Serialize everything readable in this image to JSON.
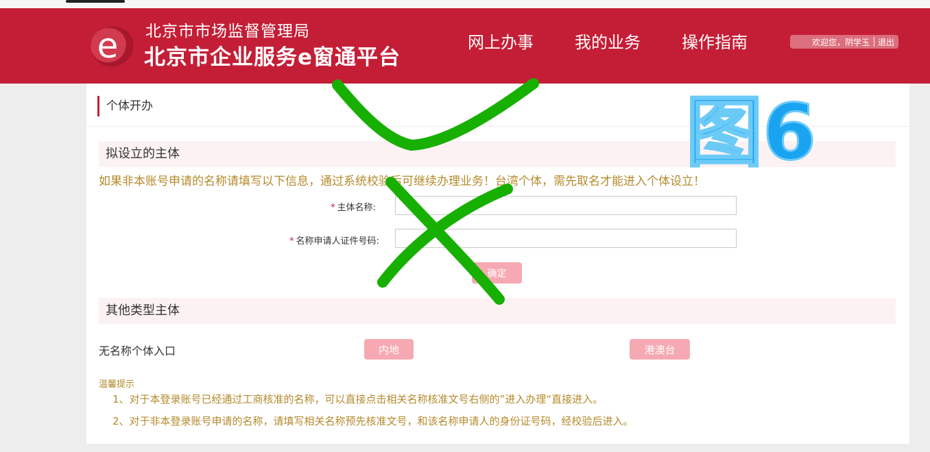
{
  "header": {
    "org_name": "北京市市场监督管理局",
    "platform_name": "北京市企业服务e窗通平台",
    "nav": [
      "网上办事",
      "我的业务",
      "操作指南"
    ],
    "welcome": "欢迎您，阴学玉",
    "logout": "退出"
  },
  "section_title": "个体开办",
  "proposed_entity": {
    "title": "拟设立的主体",
    "notice": "如果非本账号申请的名称请填写以下信息，通过系统校验后可继续办理业务！台湾个体，需先取名才能进入个体设立！",
    "fields": [
      {
        "required": "*",
        "label": "主体名称:",
        "value": ""
      },
      {
        "required": "*",
        "label": "名称申请人证件号码:",
        "value": ""
      }
    ],
    "confirm": "确定"
  },
  "other_types": {
    "title": "其他类型主体",
    "no_name_entry": "无名称个体入口",
    "mainland": "内地",
    "hk_macau_tw": "港澳台"
  },
  "tips": {
    "title": "温馨提示",
    "items": [
      "1、对于本登录账号已经通过工商核准的名称，可以直接点击相关名称核准文号右侧的”进入办理“直接进入。",
      "2、对于非本登录账号申请的名称，请填写相关名称预先核准文号，和该名称申请人的身份证号码，经校验后进入。"
    ]
  },
  "watermark": "图6",
  "colors": {
    "brand": "#c41e36",
    "button": "#f6a9b2",
    "notice": "#b48a2c",
    "band": "#fdf2f3",
    "mark": "#17b000",
    "watermark": "#1aa3f0"
  }
}
